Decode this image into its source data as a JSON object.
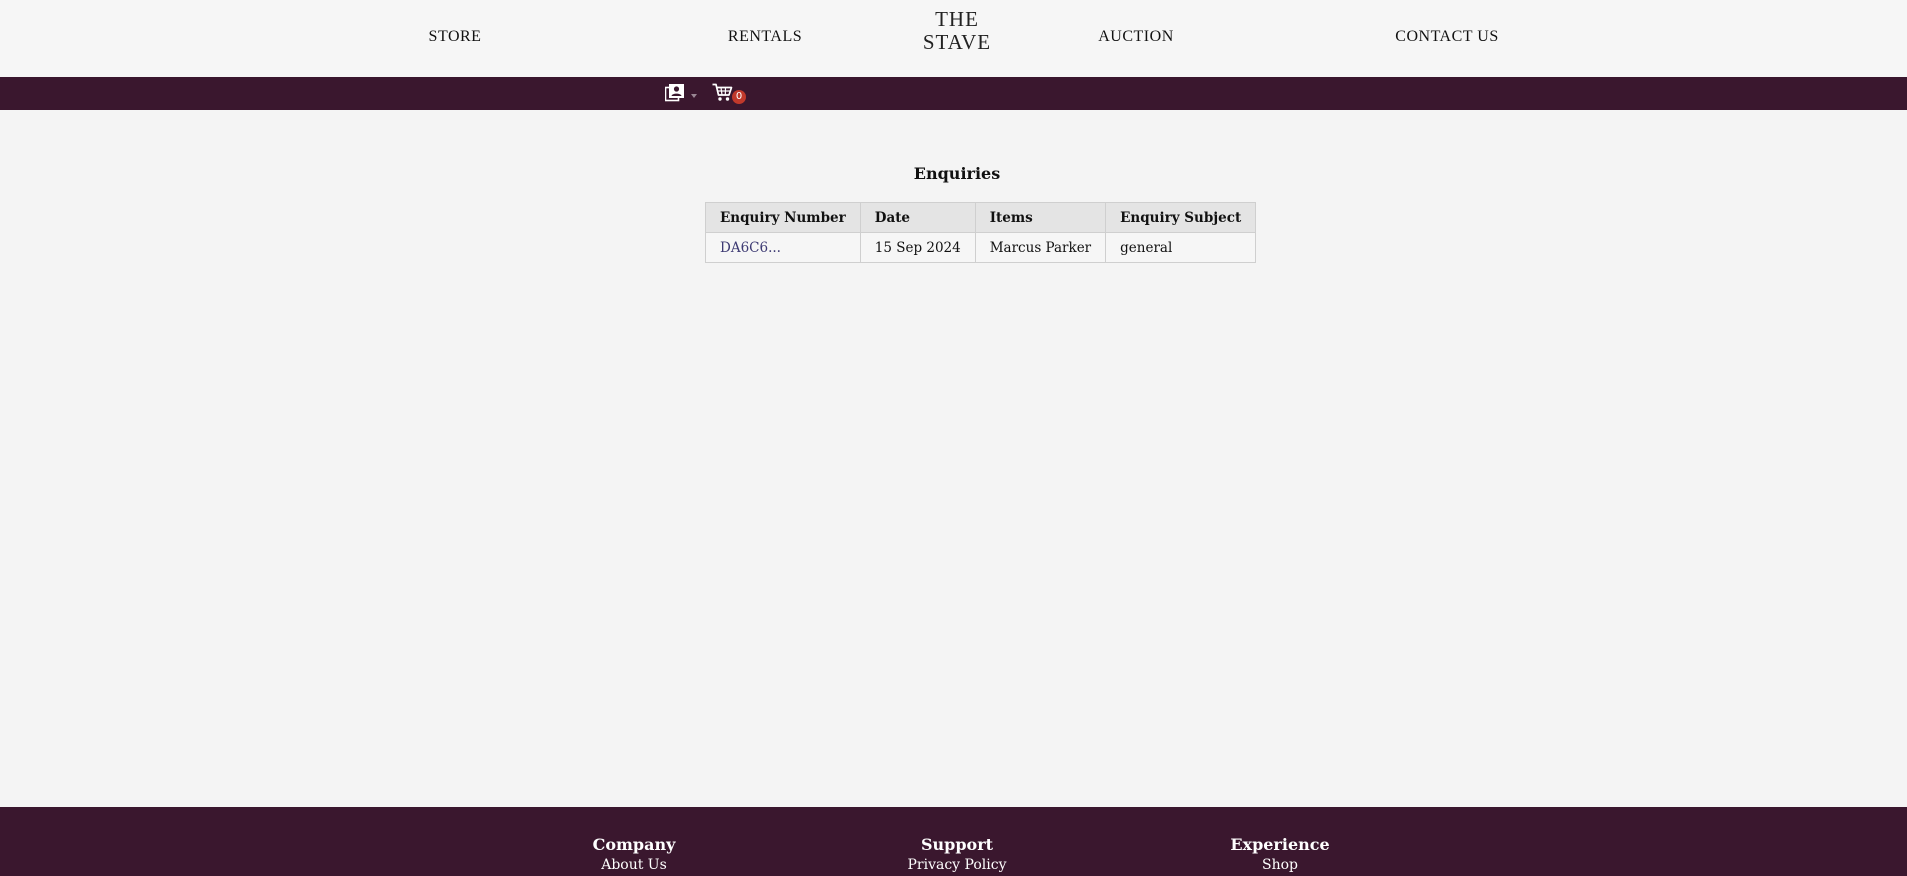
{
  "nav": {
    "store": "STORE",
    "rentals": "RENTALS",
    "logo_line1": "THE",
    "logo_line2": "STAVE",
    "auction": "AUCTION",
    "contact": "CONTACT US"
  },
  "account_bar": {
    "account_icon": "account-book-icon",
    "cart_icon": "cart-icon",
    "cart_count": "0",
    "bar_color": "#3a172e",
    "badge_color": "#c0392b"
  },
  "main": {
    "title": "Enquiries",
    "table": {
      "headers": [
        "Enquiry Number",
        "Date",
        "Items",
        "Enquiry Subject"
      ],
      "rows": [
        [
          "DA6C6...",
          "15 Sep 2024",
          "Marcus Parker",
          "general"
        ]
      ]
    },
    "link_color": "#3d3a73"
  },
  "footer": {
    "columns": [
      {
        "heading": "Company",
        "link": "About Us"
      },
      {
        "heading": "Support",
        "link": "Privacy Policy"
      },
      {
        "heading": "Experience",
        "link": "Shop"
      }
    ]
  }
}
